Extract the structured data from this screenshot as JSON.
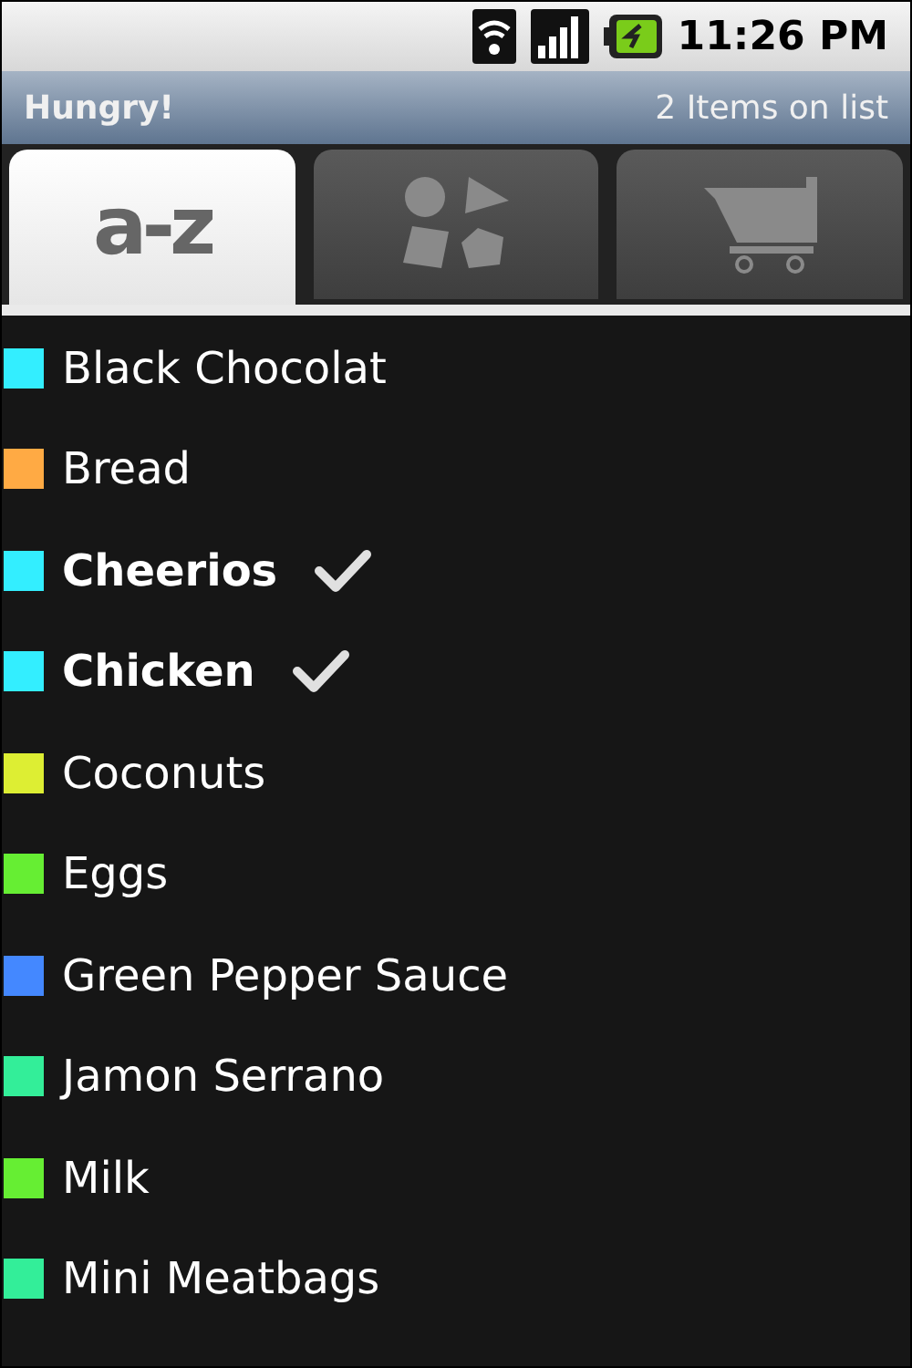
{
  "status_bar": {
    "time": "11:26 PM"
  },
  "title_bar": {
    "title": "Hungry!",
    "count": "2 Items on list"
  },
  "tabs": [
    {
      "kind": "text",
      "label": "a-z",
      "selected": true
    },
    {
      "kind": "shapes",
      "selected": false
    },
    {
      "kind": "cart",
      "selected": false
    }
  ],
  "items": [
    {
      "name": "Black Chocolat",
      "color": "#33eeff",
      "checked": false
    },
    {
      "name": "Bread",
      "color": "#ffaa44",
      "checked": false
    },
    {
      "name": "Cheerios",
      "color": "#33eeff",
      "checked": true
    },
    {
      "name": "Chicken",
      "color": "#33eeff",
      "checked": true
    },
    {
      "name": "Coconuts",
      "color": "#ddee33",
      "checked": false
    },
    {
      "name": "Eggs",
      "color": "#66ee33",
      "checked": false
    },
    {
      "name": "Green Pepper Sauce",
      "color": "#4488ff",
      "checked": false
    },
    {
      "name": "Jamon Serrano",
      "color": "#33ee99",
      "checked": false
    },
    {
      "name": "Milk",
      "color": "#66ee33",
      "checked": false
    },
    {
      "name": "Mini Meatbags",
      "color": "#33ee99",
      "checked": false
    }
  ]
}
